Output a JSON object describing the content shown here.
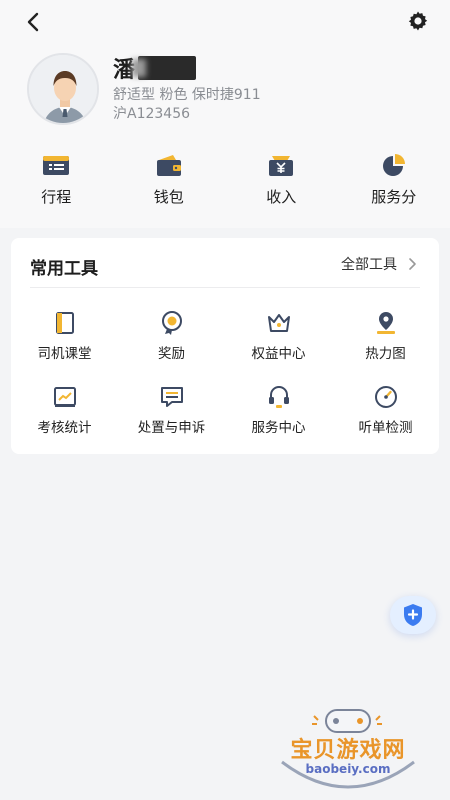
{
  "header": {
    "back_icon": "chevron-left-icon",
    "settings_icon": "gear-icon"
  },
  "profile": {
    "name": "潘",
    "car_info": "舒适型 粉色 保时捷911",
    "plate": "沪A123456"
  },
  "quick_actions": [
    {
      "label": "行程",
      "icon": "trip-icon"
    },
    {
      "label": "钱包",
      "icon": "wallet-icon"
    },
    {
      "label": "收入",
      "icon": "income-icon"
    },
    {
      "label": "服务分",
      "icon": "pie-chart-icon"
    }
  ],
  "tools": {
    "title": "常用工具",
    "all_label": "全部工具",
    "items": [
      {
        "label": "司机课堂",
        "icon": "book-icon"
      },
      {
        "label": "奖励",
        "icon": "reward-icon"
      },
      {
        "label": "权益中心",
        "icon": "crown-icon"
      },
      {
        "label": "热力图",
        "icon": "map-pin-icon"
      },
      {
        "label": "考核统计",
        "icon": "stats-icon"
      },
      {
        "label": "处置与申诉",
        "icon": "message-icon"
      },
      {
        "label": "服务中心",
        "icon": "headset-icon"
      },
      {
        "label": "听单检测",
        "icon": "gauge-icon"
      }
    ]
  },
  "fab": {
    "icon": "shield-plus-icon"
  },
  "watermark": {
    "text": "宝贝游戏网",
    "url": "baobeiy.com"
  },
  "colors": {
    "accent_yellow": "#f2b632",
    "icon_dark": "#3d4a63",
    "fab_blue": "#3b7bf0"
  }
}
